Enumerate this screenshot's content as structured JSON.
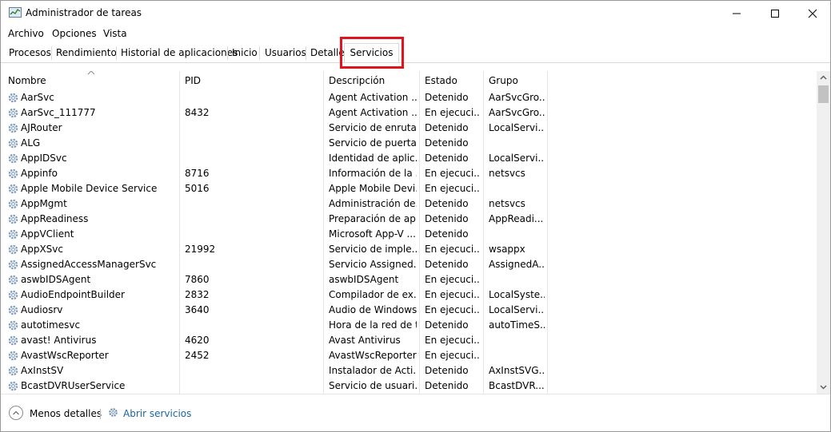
{
  "window": {
    "title": "Administrador de tareas"
  },
  "menu": {
    "items": [
      "Archivo",
      "Opciones",
      "Vista"
    ]
  },
  "tabs": {
    "items": [
      "Procesos",
      "Rendimiento",
      "Historial de aplicaciones",
      "Inicio",
      "Usuarios",
      "Detalle"
    ],
    "active": "Servicios"
  },
  "table": {
    "columns": [
      "Nombre",
      "PID",
      "Descripción",
      "Estado",
      "Grupo"
    ],
    "rows": [
      [
        "AarSvc",
        "",
        "Agent Activation ...",
        "Detenido",
        "AarSvcGro..."
      ],
      [
        "AarSvc_111777",
        "8432",
        "Agent Activation ...",
        "En ejecuci...",
        "AarSvcGro..."
      ],
      [
        "AJRouter",
        "",
        "Servicio de enruta...",
        "Detenido",
        "LocalServi..."
      ],
      [
        "ALG",
        "",
        "Servicio de puerta ...",
        "Detenido",
        ""
      ],
      [
        "AppIDSvc",
        "",
        "Identidad de aplic...",
        "Detenido",
        "LocalServi..."
      ],
      [
        "Appinfo",
        "8716",
        "Información de la ...",
        "En ejecuci...",
        "netsvcs"
      ],
      [
        "Apple Mobile Device Service",
        "5016",
        "Apple Mobile Devi...",
        "En ejecuci...",
        ""
      ],
      [
        "AppMgmt",
        "",
        "Administración de...",
        "Detenido",
        "netsvcs"
      ],
      [
        "AppReadiness",
        "",
        "Preparación de ap...",
        "Detenido",
        "AppReadi..."
      ],
      [
        "AppVClient",
        "",
        "Microsoft App-V ...",
        "Detenido",
        ""
      ],
      [
        "AppXSvc",
        "21992",
        "Servicio de imple...",
        "En ejecuci...",
        "wsappx"
      ],
      [
        "AssignedAccessManagerSvc",
        "",
        "Servicio Assigned...",
        "Detenido",
        "AssignedA..."
      ],
      [
        "aswbIDSAgent",
        "7860",
        "aswbIDSAgent",
        "En ejecuci...",
        ""
      ],
      [
        "AudioEndpointBuilder",
        "2832",
        "Compilador de ex...",
        "En ejecuci...",
        "LocalSyste..."
      ],
      [
        "Audiosrv",
        "3640",
        "Audio de Windows",
        "En ejecuci...",
        "LocalServi..."
      ],
      [
        "autotimesvc",
        "",
        "Hora de la red de t...",
        "Detenido",
        "autoTimeS..."
      ],
      [
        "avast! Antivirus",
        "4620",
        "Avast Antivirus",
        "En ejecuci...",
        ""
      ],
      [
        "AvastWscReporter",
        "2452",
        "AvastWscReporter",
        "En ejecuci...",
        ""
      ],
      [
        "AxInstSV",
        "",
        "Instalador de Acti...",
        "Detenido",
        "AxInstSVG..."
      ],
      [
        "BcastDVRUserService",
        "",
        "Servicio de usuari...",
        "Detenido",
        "BcastDVR..."
      ]
    ]
  },
  "footer": {
    "less_details": "Menos detalles",
    "open_services": "Abrir servicios"
  },
  "colors": {
    "highlight": "#e1141d",
    "link": "#1a65a8",
    "icon": "#6f8fb0"
  },
  "icons": {
    "app": "task-manager-icon",
    "service": "gear-icon",
    "less": "chevron-up-circle-icon",
    "open": "gears-icon"
  }
}
